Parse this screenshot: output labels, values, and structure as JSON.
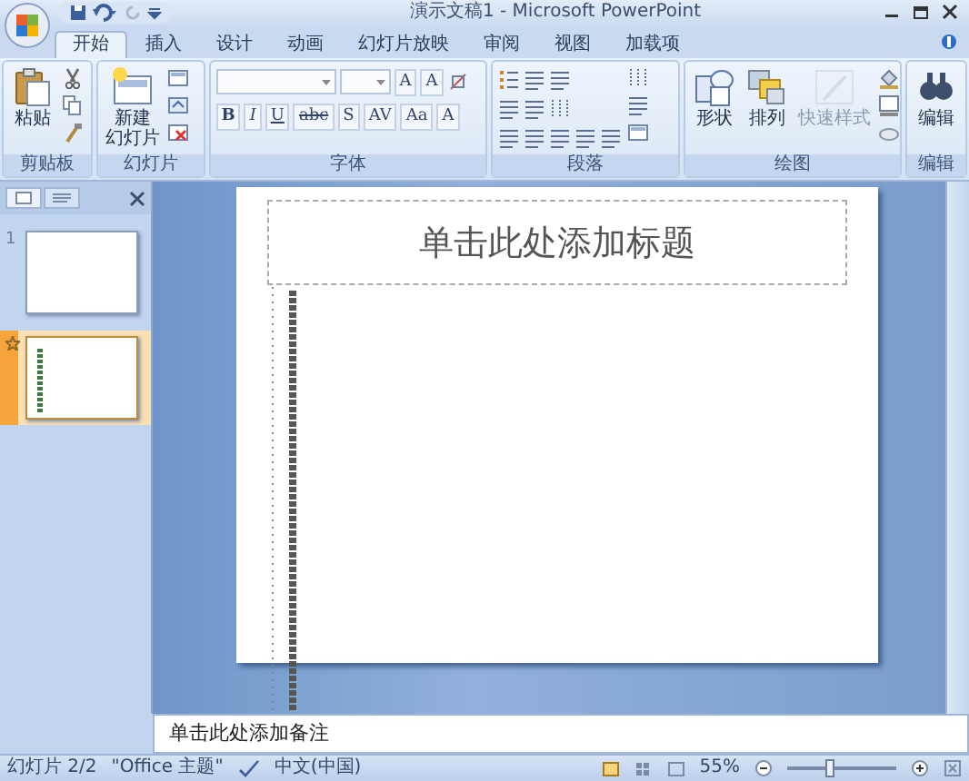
{
  "window": {
    "title": "演示文稿1 - Microsoft PowerPoint"
  },
  "tabs": [
    {
      "label": "开始",
      "selected": true
    },
    {
      "label": "插入",
      "selected": false
    },
    {
      "label": "设计",
      "selected": false
    },
    {
      "label": "动画",
      "selected": false
    },
    {
      "label": "幻灯片放映",
      "selected": false
    },
    {
      "label": "审阅",
      "selected": false
    },
    {
      "label": "视图",
      "selected": false
    },
    {
      "label": "加载项",
      "selected": false
    }
  ],
  "ribbon": {
    "groups": [
      {
        "label": "剪贴板",
        "buttons": [
          {
            "label": "粘贴",
            "disabled": false
          }
        ]
      },
      {
        "label": "幻灯片",
        "buttons": [
          {
            "label_lines": [
              "新建",
              "幻灯片"
            ],
            "disabled": false
          }
        ]
      },
      {
        "label": "字体",
        "size_keys": [
          "A",
          "A"
        ],
        "keys": [
          "B",
          "I",
          "U",
          "abc",
          "S",
          "AV",
          "Aa",
          "A"
        ]
      },
      {
        "label": "段落"
      },
      {
        "label": "绘图",
        "buttons": [
          {
            "label": "形状",
            "disabled": false
          },
          {
            "label": "排列",
            "disabled": false
          },
          {
            "label": "快速样式",
            "disabled": true
          }
        ]
      },
      {
        "label": "编辑",
        "buttons": [
          {
            "label": "编辑",
            "disabled": false
          }
        ]
      }
    ]
  },
  "slide_panel": {
    "slides": [
      {
        "number": "1",
        "selected": false,
        "kind": "blank"
      },
      {
        "selected": true,
        "kind": "text"
      }
    ]
  },
  "slide": {
    "title_placeholder": "单击此处添加标题"
  },
  "notes": {
    "placeholder": "单击此处添加备注"
  },
  "status_bar": {
    "slide": "幻灯片 2/2",
    "theme": "\"Office 主题\"",
    "language": "中文(中国)",
    "zoom": "55%",
    "zoom_slider": {
      "level": 0.38
    }
  }
}
